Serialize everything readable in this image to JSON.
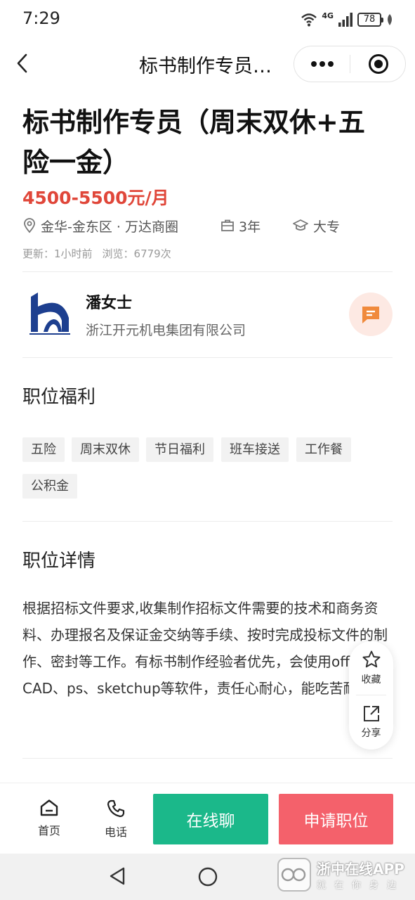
{
  "status_bar": {
    "time": "7:29",
    "network": "4G",
    "battery": "78"
  },
  "nav": {
    "title": "标书制作专员…"
  },
  "job": {
    "title": "标书制作专员（周末双休+五险一金）",
    "salary": "4500-5500元/月",
    "location": "金华-金东区 · 万达商圈",
    "experience": "3年",
    "education": "大专",
    "updated": "更新：1小时前",
    "views": "浏览：6779次"
  },
  "recruiter": {
    "name": "潘女士",
    "company": "浙江开元机电集团有限公司"
  },
  "benefits": {
    "title": "职位福利",
    "tags": [
      "五险",
      "周末双休",
      "节日福利",
      "班车接送",
      "工作餐",
      "公积金"
    ]
  },
  "details": {
    "title": "职位详情",
    "text": "根据招标文件要求,收集制作招标文件需要的技术和商务资料、办理报名及保证金交纳等手续、按时完成投标文件的制作、密封等工作。有标书制作经验者优先，会使用office、CAD、ps、sketchup等软件，责任心耐心，能吃苦耐劳。"
  },
  "floating": {
    "favorite": "收藏",
    "share": "分享"
  },
  "bottom_bar": {
    "home": "首页",
    "phone": "电话",
    "chat": "在线聊",
    "apply": "申请职位"
  },
  "watermark": {
    "name": "浙中在线APP",
    "slogan": "就在你身边"
  },
  "colors": {
    "salary": "#e0473a",
    "chat_button": "#1bb88a",
    "apply_button": "#f4616b",
    "chat_icon": "#f08a3c"
  }
}
